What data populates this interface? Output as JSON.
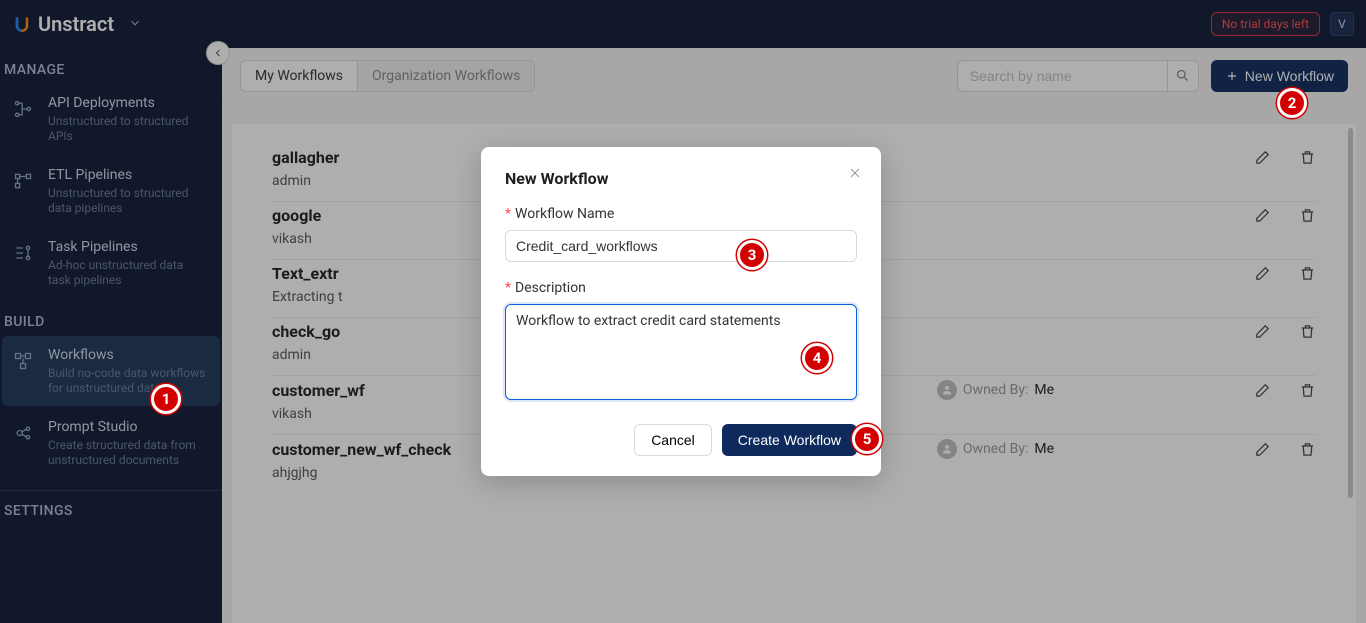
{
  "header": {
    "brand": "Unstract",
    "trial_badge": "No trial days left",
    "avatar_initial": "V"
  },
  "sidebar": {
    "sections": [
      {
        "title": "MANAGE",
        "items": [
          {
            "title": "API Deployments",
            "desc": "Unstructured to structured APIs"
          },
          {
            "title": "ETL Pipelines",
            "desc": "Unstructured to structured data pipelines"
          },
          {
            "title": "Task Pipelines",
            "desc": "Ad-hoc unstructured data task pipelines"
          }
        ]
      },
      {
        "title": "BUILD",
        "items": [
          {
            "title": "Workflows",
            "desc": "Build no-code data workflows for unstructured data"
          },
          {
            "title": "Prompt Studio",
            "desc": "Create structured data from unstructured documents"
          }
        ]
      },
      {
        "title": "SETTINGS",
        "items": []
      }
    ]
  },
  "toolbar": {
    "tabs": [
      "My Workflows",
      "Organization Workflows"
    ],
    "search_placeholder": "Search by name",
    "new_button": "New Workflow"
  },
  "workflows": [
    {
      "name": "gallagher",
      "sub": "admin",
      "owned_by_label": "",
      "owned_by": ""
    },
    {
      "name": "google",
      "sub": "vikash",
      "owned_by_label": "",
      "owned_by": ""
    },
    {
      "name": "Text_extr",
      "sub": "Extracting t",
      "owned_by_label": "",
      "owned_by": ""
    },
    {
      "name": "check_go",
      "sub": "admin",
      "owned_by_label": "",
      "owned_by": ""
    },
    {
      "name": "customer_wf",
      "sub": "vikash",
      "owned_by_label": "Owned By:",
      "owned_by": "Me"
    },
    {
      "name": "customer_new_wf_check",
      "sub": "ahjgjhg",
      "owned_by_label": "Owned By:",
      "owned_by": "Me"
    }
  ],
  "modal": {
    "title": "New Workflow",
    "name_label": "Workflow Name",
    "name_value": "Credit_card_workflows",
    "desc_label": "Description",
    "desc_value": "Workflow to extract credit card statements",
    "cancel_label": "Cancel",
    "create_label": "Create Workflow"
  },
  "markers": {
    "1": "1",
    "2": "2",
    "3": "3",
    "4": "4",
    "5": "5"
  }
}
